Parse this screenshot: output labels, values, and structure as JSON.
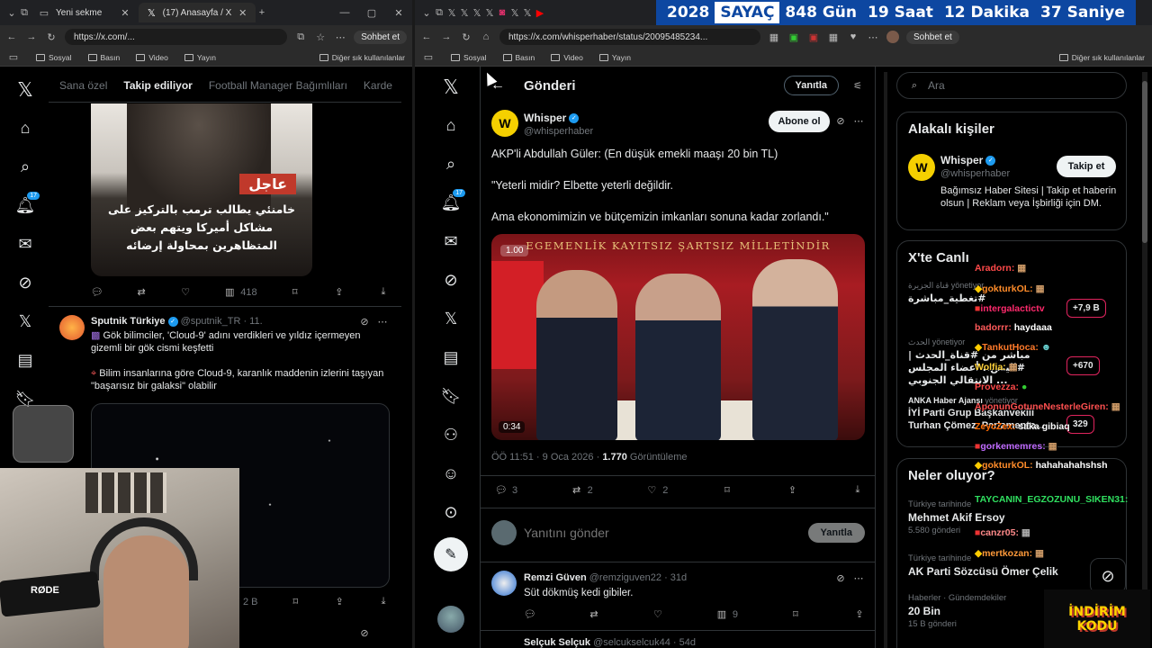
{
  "left": {
    "tabs": [
      {
        "label": "Yeni sekme"
      },
      {
        "label": "(17) Anasayfa / X"
      }
    ],
    "url": "https://x.com/...",
    "profile_btn": "Sohbet et",
    "bookmarks": [
      "Sosyal",
      "Basın",
      "Video",
      "Yayın"
    ],
    "other_bookmarks": "Diğer sık kullanılanlar",
    "feed_tabs": [
      "Sana özel",
      "Takip ediliyor",
      "Football Manager Bağımlıları",
      "Karde"
    ],
    "notif_count": "17",
    "media1": {
      "arabic_tag": "عاجل",
      "arabic_text": "خامنئي يطالب ترمب بالتركيز على مشاكل أميركا ويتهم بعض المتظاهرين بمحاولة إرضائه"
    },
    "views1": "418",
    "tweet2": {
      "name": "Sputnik Türkiye",
      "handle": "@sputnik_TR · 11.",
      "line1": "Gök bilimciler, 'Cloud-9' adını verdikleri ve yıldız içermeyen gizemli bir gök cismi keşfetti",
      "line2": "Bilim insanlarına göre Cloud-9, karanlık maddenin izlerini taşıyan \"başarısız bir galaksi\" olabilir"
    },
    "views2": "2 B",
    "mic_label": "RØDE"
  },
  "right": {
    "url": "https://x.com/whisperhaber/status/20095485234...",
    "profile_btn": "Sohbet et",
    "counter": [
      {
        "value": "2028",
        "unit": ""
      },
      {
        "value": "SAYAÇ",
        "unit": ""
      },
      {
        "value": "848",
        "unit": "Gün"
      },
      {
        "value": "19",
        "unit": "Saat"
      },
      {
        "value": "12",
        "unit": "Dakika"
      },
      {
        "value": "37",
        "unit": "Saniye"
      }
    ],
    "bookmarks": [
      "Sosyal",
      "Basın",
      "Video",
      "Yayın"
    ],
    "other_bookmarks": "Diğer sık kullanılanlar",
    "notif_count": "17",
    "header_title": "Gönderi",
    "reply_btn": "Yanıtla",
    "post": {
      "name": "Whisper",
      "handle": "@whisperhaber",
      "follow": "Abone ol",
      "p1": "AKP'li Abdullah Güler: (En düşük emekli maaşı 20 bin TL)",
      "p2": "\"Yeterli midir? Elbette yeterli değildir.",
      "p3": "Ama ekonomimizin ve bütçemizin imkanları sonuna kadar zorlandı.\"",
      "video_banner": "EGEMENLİK KAYITSIZ ŞARTSIZ MİLLETİNDİR",
      "speed": "1.00",
      "duration": "0:34",
      "time": "ÖÖ 11:51 · 9 Oca 2026 · ",
      "views": "1.770",
      "views_label": " Görüntüleme",
      "replies": "3",
      "reposts": "2",
      "likes": "2"
    },
    "reply_box": {
      "placeholder": "Yanıtını gönder",
      "button": "Yanıtla"
    },
    "reply1": {
      "name": "Remzi Güven",
      "handle": "@remziguven22 · 31d",
      "text": "Süt dökmüş kedi gibiler.",
      "views": "9"
    },
    "reply2": {
      "name": "Selçuk Selçuk",
      "handle": "@selcukselcuk44 · 54d"
    },
    "search_placeholder": "Ara",
    "related": {
      "title": "Alakalı kişiler",
      "name": "Whisper",
      "handle": "@whisperhaber",
      "follow": "Takip et",
      "bio": "Bağımsız Haber Sitesi | Takip et haberin olsun | Reklam veya İşbirliği için DM."
    },
    "live": {
      "title": "X'te Canlı",
      "items": [
        {
          "host": "قناة الجزيرة",
          "title": "#تغطية_مباشرة"
        },
        {
          "host": "الحدث",
          "title": "مباشر من #قناة_الحدث | #اليمن.. أعضاء المجلس الانتقالي الجنوبي ..."
        },
        {
          "host": "ANKA Haber Ajansı",
          "title": "İYİ Parti Grup Başkanvekili Turhan Çömez, Parlamento..."
        }
      ],
      "counts": [
        "+7,9 B",
        "+670",
        "329"
      ],
      "host_suffix": "yönetiyor"
    },
    "trends": {
      "title": "Neler oluyor?",
      "items": [
        {
          "ctx": "Türkiye tarihinde",
          "name": "Mehmet Akif Ersoy",
          "count": "5.580 gönderi"
        },
        {
          "ctx": "Türkiye tarihinde",
          "name": "AK Parti Sözcüsü Ömer Çelik",
          "count": ""
        },
        {
          "ctx": "Haberler · Gündemdekiler",
          "name": "20 Bin",
          "count": "15 B gönderi"
        }
      ]
    }
  },
  "chat": [
    {
      "user": "Aradorn:",
      "msg": "",
      "color": "#ff4a4a"
    },
    {
      "user": "gokturkOL:",
      "msg": "",
      "color": "#ff8c2a"
    },
    {
      "user": "intergalactictv",
      "msg": "",
      "color": "#ff2a6d"
    },
    {
      "user": "badorrr:",
      "msg": "haydaaa",
      "color": "#ff5a5a"
    },
    {
      "user": "TankutHoca:",
      "msg": "",
      "color": "#ff7a2a"
    },
    {
      "user": "Wolfia:",
      "msg": "",
      "color": "#ffd23a"
    },
    {
      "user": "Provezza:",
      "msg": "",
      "color": "#ff4a4a"
    },
    {
      "user": "AponunGotuneNesterleGiren:",
      "msg": "",
      "color": "#ff5050"
    },
    {
      "user": "ZeycZex:",
      "msg": "saka gibiaq",
      "color": "#ff6a00"
    },
    {
      "user": "gorkememres:",
      "msg": "",
      "color": "#c06bff"
    },
    {
      "user": "gokturkOL:",
      "msg": "hahahahahshsh",
      "color": "#ff8c2a"
    },
    {
      "user": "TAYCANIN_EGZOZUNU_SIKEN31:",
      "msg": "",
      "color": "#30e060"
    },
    {
      "user": "canzr05:",
      "msg": "",
      "color": "#ff8a8a"
    },
    {
      "user": "mertkozan:",
      "msg": "",
      "color": "#ff9a3a"
    }
  ],
  "promo": {
    "line1": "İNDİRİM",
    "line2": "KODU"
  },
  "colors": {
    "accent": "#1d9bf0",
    "counter_bg": "#1565c0"
  }
}
